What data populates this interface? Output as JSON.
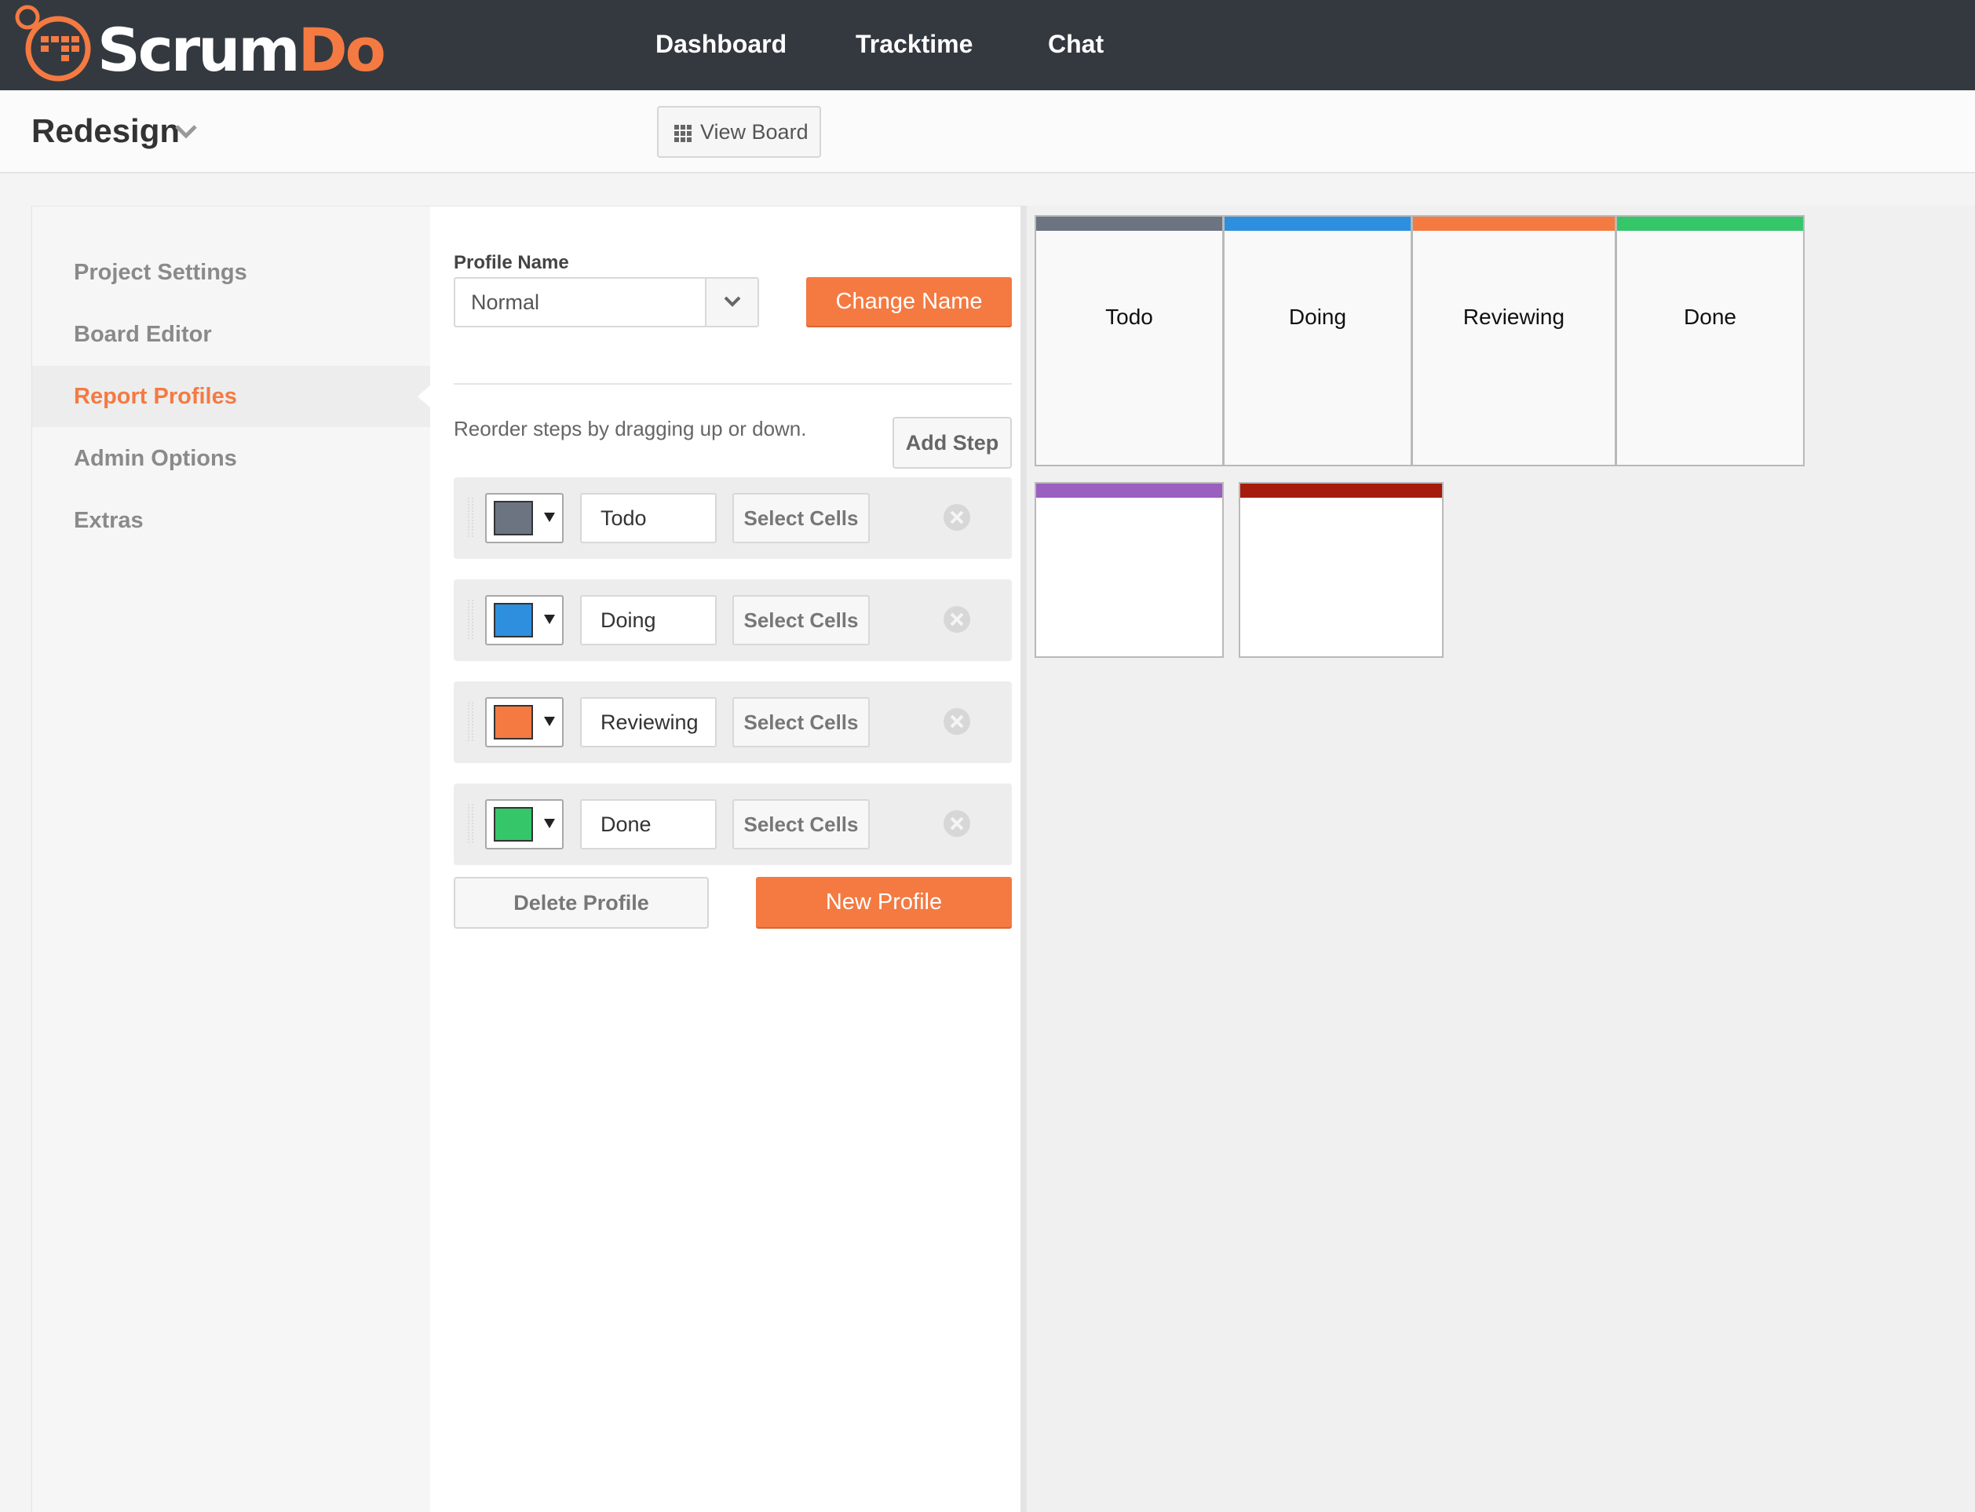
{
  "app": {
    "logo_text_a": "Scrum",
    "logo_text_b": "Do",
    "brand_color": "#f47a42",
    "nav": [
      "Dashboard",
      "Tracktime",
      "Chat"
    ]
  },
  "header": {
    "project_title": "Redesign",
    "view_board_label": "View Board"
  },
  "sidebar": {
    "items": [
      {
        "label": "Project Settings",
        "active": false
      },
      {
        "label": "Board Editor",
        "active": false
      },
      {
        "label": "Report Profiles",
        "active": true
      },
      {
        "label": "Admin Options",
        "active": false
      },
      {
        "label": "Extras",
        "active": false
      }
    ]
  },
  "form": {
    "profile_name_label": "Profile Name",
    "profile_select_value": "Normal",
    "change_name_label": "Change Name",
    "help_text": "Reorder steps by dragging up or down.",
    "add_step_label": "Add Step",
    "select_cells_label": "Select Cells",
    "steps": [
      {
        "name": "Todo",
        "color": "#6b7480"
      },
      {
        "name": "Doing",
        "color": "#2d8fdd"
      },
      {
        "name": "Reviewing",
        "color": "#f47a42"
      },
      {
        "name": "Done",
        "color": "#35c66a"
      }
    ],
    "delete_profile_label": "Delete Profile",
    "new_profile_label": "New Profile"
  },
  "preview": {
    "cells": [
      {
        "label": "Todo",
        "color": "#6b7480"
      },
      {
        "label": "Doing",
        "color": "#2d8fdd"
      },
      {
        "label": "Reviewing",
        "color": "#f47a42"
      },
      {
        "label": "Done",
        "color": "#35c66a"
      },
      {
        "label": "",
        "color": "#9b5fc0"
      },
      {
        "label": "",
        "color": "#a51c0c"
      }
    ]
  }
}
